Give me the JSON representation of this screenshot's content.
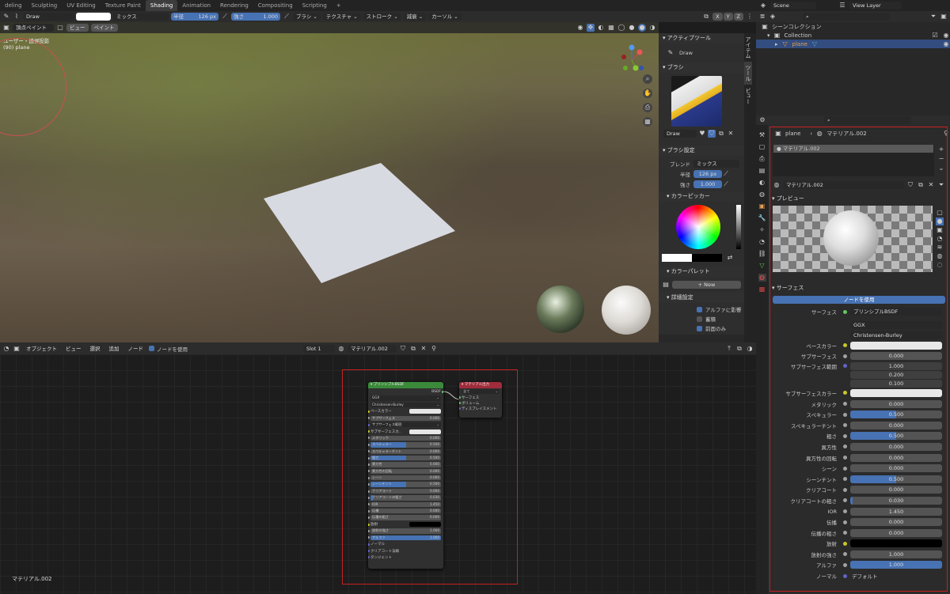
{
  "workspace_tabs": [
    "deling",
    "Sculpting",
    "UV Editing",
    "Texture Paint",
    "Shading",
    "Animation",
    "Rendering",
    "Compositing",
    "Scripting",
    "+"
  ],
  "scene": "Scene",
  "view_layer": "View Layer",
  "tool_header": {
    "brush": "Draw",
    "blend": "ミックス",
    "radius_label": "半径",
    "radius": "126 px",
    "strength_label": "強さ",
    "strength": "1.000",
    "menus": [
      "ブラシ",
      "テクスチャ",
      "ストローク",
      "減衰",
      "カーソル"
    ],
    "axes": [
      "X",
      "Y",
      "Z"
    ]
  },
  "viewport_header": {
    "mode": "頂点ペイント",
    "menus": [
      "ビュー",
      "ペイント"
    ]
  },
  "viewport": {
    "view_label": "ユーザー・透視投影",
    "object_label": "(90) plane"
  },
  "side_panel": {
    "tabs": [
      "アイテム",
      "ツール",
      "ビュー"
    ],
    "active_tool_title": "アクティブツール",
    "active_tool": "Draw",
    "brush_title": "ブラシ",
    "brush_name": "Draw",
    "brush_settings_title": "ブラシ設定",
    "blend_label": "ブレンド",
    "blend_value": "ミックス",
    "radius_label": "半径",
    "radius_value": "126 px",
    "strength_label": "強さ",
    "strength_value": "1.000",
    "color_picker_title": "カラーピッカー",
    "palette_title": "カラーパレット",
    "palette_new": "New",
    "advanced_title": "詳細設定",
    "checks": [
      {
        "label": "アルファに影響",
        "checked": true
      },
      {
        "label": "蓄積",
        "checked": false
      },
      {
        "label": "前面のみ",
        "checked": true
      }
    ]
  },
  "node_header": {
    "menus": [
      "オブジェクト",
      "ビュー",
      "選択",
      "追加",
      "ノード"
    ],
    "use_nodes": "ノードを使用",
    "slot": "Slot 1",
    "material": "マテリアル.002"
  },
  "node_editor": {
    "material_label": "マテリアル.002"
  },
  "bsdf_node": {
    "title": "プリンシプルBSDF",
    "output": "BSDF",
    "distribution": "GGX",
    "subsurface_method": "Christensen-Burley",
    "rows": [
      {
        "label": "ベースカラー",
        "type": "color",
        "color": "#e6e6e6"
      },
      {
        "label": "サブサーフェス",
        "value": "0.000",
        "fill": 0
      },
      {
        "label": "サブサーフェス範囲",
        "type": "menu"
      },
      {
        "label": "サブサーフェスカ..",
        "type": "color",
        "color": "#e6e6e6"
      },
      {
        "label": "メタリック",
        "value": "0.000",
        "fill": 0
      },
      {
        "label": "スペキュラー",
        "value": "0.500",
        "fill": 0.5
      },
      {
        "label": "スペキュラーチント",
        "value": "0.000",
        "fill": 0
      },
      {
        "label": "粗さ",
        "value": "0.500",
        "fill": 0.5
      },
      {
        "label": "異方性",
        "value": "0.000",
        "fill": 0
      },
      {
        "label": "異方性の回転",
        "value": "0.000",
        "fill": 0
      },
      {
        "label": "シーン",
        "value": "0.000",
        "fill": 0
      },
      {
        "label": "シーンチント",
        "value": "0.500",
        "fill": 0.5
      },
      {
        "label": "クリアコート",
        "value": "0.000",
        "fill": 0
      },
      {
        "label": "クリアコートの粗さ",
        "value": "0.030",
        "fill": 0.03
      },
      {
        "label": "IOR",
        "value": "1.450",
        "fill": 0
      },
      {
        "label": "伝播",
        "value": "0.000",
        "fill": 0
      },
      {
        "label": "伝播の粗さ",
        "value": "0.000",
        "fill": 0
      },
      {
        "label": "放射",
        "type": "color",
        "color": "#000000"
      },
      {
        "label": "放射の強さ",
        "value": "1.000",
        "fill": 0
      },
      {
        "label": "アルファ",
        "value": "1.000",
        "fill": 1
      },
      {
        "label": "ノーマル",
        "type": "plain"
      },
      {
        "label": "クリアコート法線",
        "type": "plain"
      },
      {
        "label": "タンジェント",
        "type": "plain"
      }
    ]
  },
  "output_node": {
    "title": "マテリアル出力",
    "target": "全て",
    "sockets": [
      "サーフェス",
      "ボリューム",
      "ディスプレイスメント"
    ]
  },
  "outliner": {
    "scene_collection": "シーンコレクション",
    "collection": "Collection",
    "object": "plane"
  },
  "properties": {
    "object": "plane",
    "material": "マテリアル.002",
    "slot_item": "マテリアル.002",
    "material_field": "マテリアル.002",
    "preview_title": "プレビュー",
    "surface_title": "サーフェス",
    "use_nodes": "ノードを使用",
    "surface_label": "サーフェス",
    "surface_value": "プリンシプルBSDF",
    "distribution": "GGX",
    "subsurface_method": "Christensen-Burley",
    "rows": [
      {
        "label": "ベースカラー",
        "type": "color",
        "color": "#e8e8e8",
        "dot": "#c7c729"
      },
      {
        "label": "サブサーフェス",
        "value": "0.000",
        "fill": 0,
        "dot": "#a1a1a1"
      },
      {
        "label": "サブサーフェス範囲",
        "type": "vector",
        "values": [
          "1.000",
          "0.200",
          "0.100"
        ],
        "dot": "#6363c7"
      },
      {
        "label": "サブサーフェスカラー",
        "type": "color",
        "color": "#e8e8e8",
        "dot": "#c7c729"
      },
      {
        "label": "メタリック",
        "value": "0.000",
        "fill": 0,
        "dot": "#a1a1a1"
      },
      {
        "label": "スペキュラー",
        "value": "0.500",
        "fill": 0.5,
        "dot": "#a1a1a1"
      },
      {
        "label": "スペキュラーチント",
        "value": "0.000",
        "fill": 0,
        "dot": "#a1a1a1"
      },
      {
        "label": "粗さ",
        "value": "0.500",
        "fill": 0.5,
        "dot": "#a1a1a1"
      },
      {
        "label": "異方性",
        "value": "0.000",
        "fill": 0,
        "dot": "#a1a1a1"
      },
      {
        "label": "異方性の回転",
        "value": "0.000",
        "fill": 0,
        "dot": "#a1a1a1"
      },
      {
        "label": "シーン",
        "value": "0.000",
        "fill": 0,
        "dot": "#a1a1a1"
      },
      {
        "label": "シーンチント",
        "value": "0.500",
        "fill": 0.5,
        "dot": "#a1a1a1"
      },
      {
        "label": "クリアコート",
        "value": "0.000",
        "fill": 0,
        "dot": "#a1a1a1"
      },
      {
        "label": "クリアコートの粗さ",
        "value": "0.030",
        "fill": 0.03,
        "dot": "#a1a1a1"
      },
      {
        "label": "IOR",
        "value": "1.450",
        "fill": 0,
        "dot": "#a1a1a1"
      },
      {
        "label": "伝播",
        "value": "0.000",
        "fill": 0,
        "dot": "#a1a1a1"
      },
      {
        "label": "伝播の粗さ",
        "value": "0.000",
        "fill": 0,
        "dot": "#a1a1a1"
      },
      {
        "label": "放射",
        "type": "color",
        "color": "#000000",
        "dot": "#c7c729"
      },
      {
        "label": "放射の強さ",
        "value": "1.000",
        "fill": 0,
        "dot": "#a1a1a1"
      },
      {
        "label": "アルファ",
        "value": "1.000",
        "fill": 1,
        "dot": "#a1a1a1"
      },
      {
        "label": "ノーマル",
        "type": "text",
        "value": "デフォルト",
        "dot": "#6363c7"
      }
    ]
  },
  "colors": {
    "accent": "#4772b3",
    "highlight_red": "#c62020",
    "bsdf_header": "#3a8a3a",
    "output_header": "#a02b3a"
  }
}
